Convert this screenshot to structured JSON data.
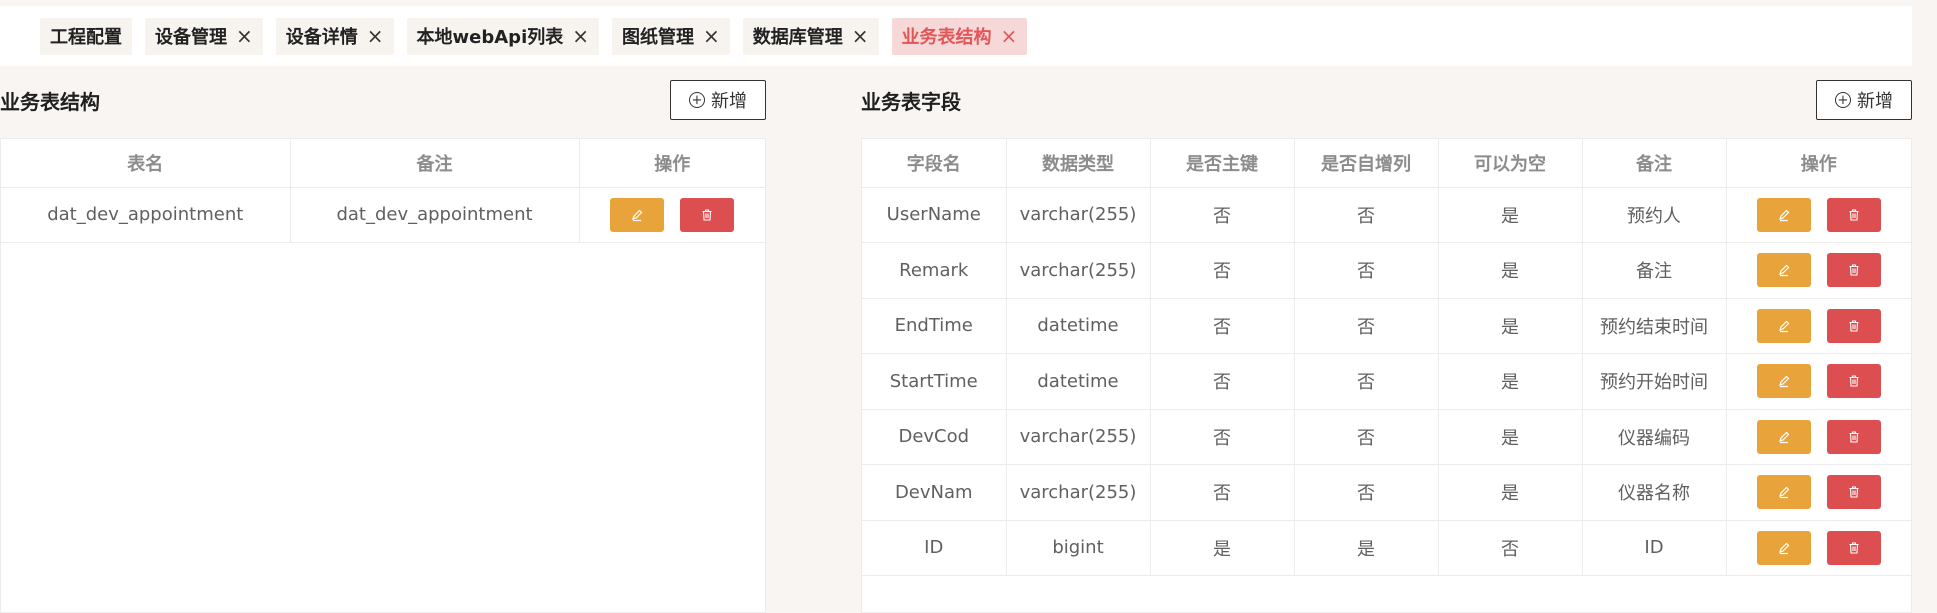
{
  "tabs": [
    {
      "label": "工程配置",
      "closable": false,
      "active": false
    },
    {
      "label": "设备管理",
      "closable": true,
      "active": false
    },
    {
      "label": "设备详情",
      "closable": true,
      "active": false
    },
    {
      "label": "本地webApi列表",
      "closable": true,
      "active": false
    },
    {
      "label": "图纸管理",
      "closable": true,
      "active": false
    },
    {
      "label": "数据库管理",
      "closable": true,
      "active": false
    },
    {
      "label": "业务表结构",
      "closable": true,
      "active": true
    }
  ],
  "left_panel": {
    "title": "业务表结构",
    "add_label": "新增",
    "columns": [
      "表名",
      "备注",
      "操作"
    ],
    "rows": [
      {
        "name": "dat_dev_appointment",
        "remark": "dat_dev_appointment"
      }
    ]
  },
  "right_panel": {
    "title": "业务表字段",
    "add_label": "新增",
    "columns": [
      "字段名",
      "数据类型",
      "是否主键",
      "是否自增列",
      "可以为空",
      "备注",
      "操作"
    ],
    "rows": [
      {
        "field": "UserName",
        "type": "varchar(255)",
        "pk": "否",
        "auto": "否",
        "nullable": "是",
        "remark": "预约人"
      },
      {
        "field": "Remark",
        "type": "varchar(255)",
        "pk": "否",
        "auto": "否",
        "nullable": "是",
        "remark": "备注"
      },
      {
        "field": "EndTime",
        "type": "datetime",
        "pk": "否",
        "auto": "否",
        "nullable": "是",
        "remark": "预约结束时间"
      },
      {
        "field": "StartTime",
        "type": "datetime",
        "pk": "否",
        "auto": "否",
        "nullable": "是",
        "remark": "预约开始时间"
      },
      {
        "field": "DevCod",
        "type": "varchar(255)",
        "pk": "否",
        "auto": "否",
        "nullable": "是",
        "remark": "仪器编码"
      },
      {
        "field": "DevNam",
        "type": "varchar(255)",
        "pk": "否",
        "auto": "否",
        "nullable": "是",
        "remark": "仪器名称"
      },
      {
        "field": "ID",
        "type": "bigint",
        "pk": "是",
        "auto": "是",
        "nullable": "否",
        "remark": "ID"
      }
    ]
  },
  "icons": {
    "close": "close-icon",
    "add": "plus-circle-icon",
    "edit": "edit-icon",
    "delete": "trash-icon"
  },
  "colors": {
    "active_tab_bg": "#f7d8d8",
    "active_tab_text": "#e0575a",
    "edit_button": "#e8a43a",
    "delete_button": "#dc4e50"
  }
}
